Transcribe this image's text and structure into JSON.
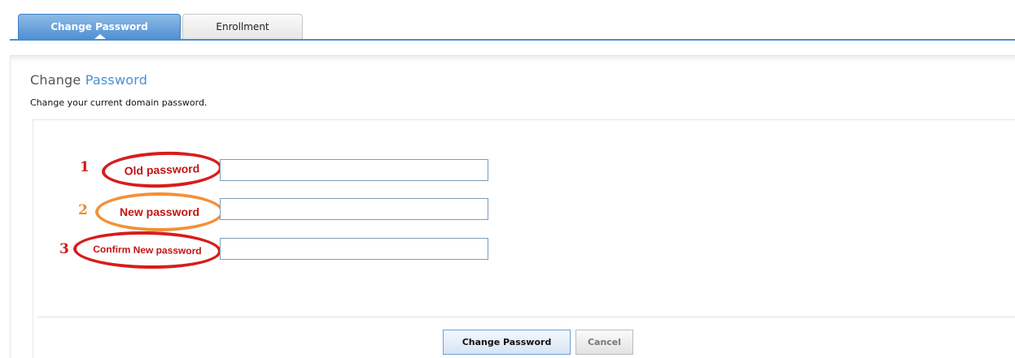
{
  "tabs": [
    {
      "label": "Change Password",
      "active": true
    },
    {
      "label": "Enrollment",
      "active": false
    }
  ],
  "header": {
    "title_part1": "Change",
    "title_part2": "Password",
    "description": "Change your current domain password."
  },
  "form": {
    "fields": [
      {
        "number": "1",
        "label": "Old password",
        "value": "",
        "annotation_color": "#d81c1c"
      },
      {
        "number": "2",
        "label": "New password",
        "value": "",
        "annotation_color": "#f39138"
      },
      {
        "number": "3",
        "label": "Confirm New password",
        "value": "",
        "annotation_color": "#d81c1c"
      }
    ]
  },
  "buttons": {
    "submit_label": "Change Password",
    "cancel_label": "Cancel"
  },
  "colors": {
    "accent": "#4a8fd4",
    "annotation_red": "#d81c1c",
    "annotation_orange": "#f39138"
  }
}
